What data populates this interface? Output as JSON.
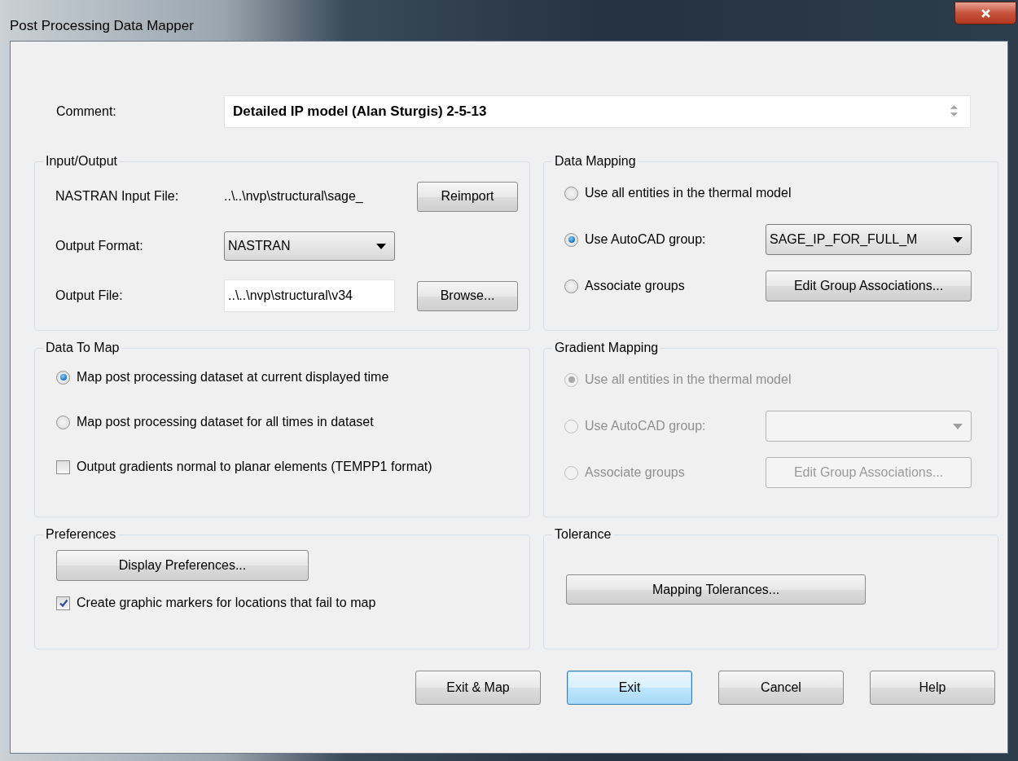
{
  "window": {
    "title": "Post Processing Data Mapper"
  },
  "comment": {
    "label": "Comment:",
    "value": "Detailed IP model (Alan Sturgis) 2-5-13"
  },
  "input_output": {
    "title": "Input/Output",
    "input_file": {
      "label": "NASTRAN Input File:",
      "value": "..\\..\\nvp\\structural\\sage_",
      "button": "Reimport"
    },
    "output_format": {
      "label": "Output Format:",
      "value": "NASTRAN"
    },
    "output_file": {
      "label": "Output File:",
      "value": "..\\..\\nvp\\structural\\v34",
      "button": "Browse..."
    }
  },
  "data_mapping": {
    "title": "Data Mapping",
    "disabled": false,
    "options": [
      {
        "label": "Use all entities in the thermal model",
        "selected": false
      },
      {
        "label": "Use AutoCAD group:",
        "selected": true
      },
      {
        "label": "Associate groups",
        "selected": false
      }
    ],
    "group_dropdown": {
      "value": "SAGE_IP_FOR_FULL_M"
    },
    "edit_button": "Edit Group Associations..."
  },
  "data_to_map": {
    "title": "Data To Map",
    "items": [
      {
        "kind": "radio",
        "label": "Map post processing dataset at current displayed time",
        "selected": true
      },
      {
        "kind": "radio",
        "label": "Map post processing dataset for all times in dataset",
        "selected": false
      },
      {
        "kind": "checkbox",
        "label": "Output gradients normal to planar elements (TEMPP1 format)",
        "checked": false
      }
    ]
  },
  "gradient_mapping": {
    "title": "Gradient Mapping",
    "disabled": true,
    "options": [
      {
        "label": "Use all entities in the thermal model",
        "selected": true
      },
      {
        "label": "Use AutoCAD group:",
        "selected": false
      },
      {
        "label": "Associate groups",
        "selected": false
      }
    ],
    "edit_button": "Edit Group Associations..."
  },
  "preferences": {
    "title": "Preferences",
    "button": "Display Preferences...",
    "checkbox": {
      "label": "Create graphic markers for locations that fail to map",
      "checked": true
    }
  },
  "tolerance": {
    "title": "Tolerance",
    "button": "Mapping Tolerances..."
  },
  "buttons": [
    {
      "label": "Exit & Map",
      "default": false
    },
    {
      "label": "Exit",
      "default": true
    },
    {
      "label": "Cancel",
      "default": false
    },
    {
      "label": "Help",
      "default": false
    }
  ]
}
